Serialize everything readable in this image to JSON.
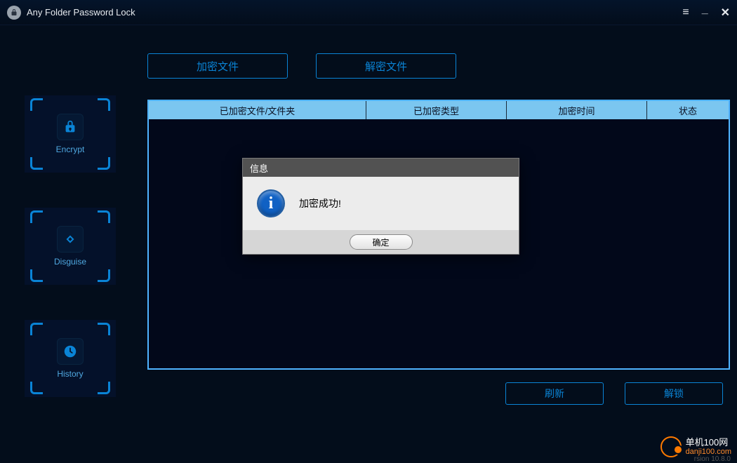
{
  "app": {
    "title": "Any Folder Password Lock"
  },
  "sidebar": {
    "items": [
      {
        "label": "Encrypt",
        "icon": "lock-icon"
      },
      {
        "label": "Disguise",
        "icon": "eye-icon"
      },
      {
        "label": "History",
        "icon": "clock-icon"
      }
    ]
  },
  "top_actions": {
    "encrypt": "加密文件",
    "decrypt": "解密文件"
  },
  "table": {
    "headers": {
      "path": "已加密文件/文件夹",
      "type": "已加密类型",
      "time": "加密时间",
      "status": "状态"
    },
    "rows": []
  },
  "bottom_actions": {
    "refresh": "刷新",
    "unlock": "解锁"
  },
  "modal": {
    "title": "信息",
    "message": "加密成功!",
    "ok": "确定"
  },
  "watermark": {
    "line1": "单机100网",
    "line2": "danji100.com"
  },
  "version": "rsion 10.8.0"
}
